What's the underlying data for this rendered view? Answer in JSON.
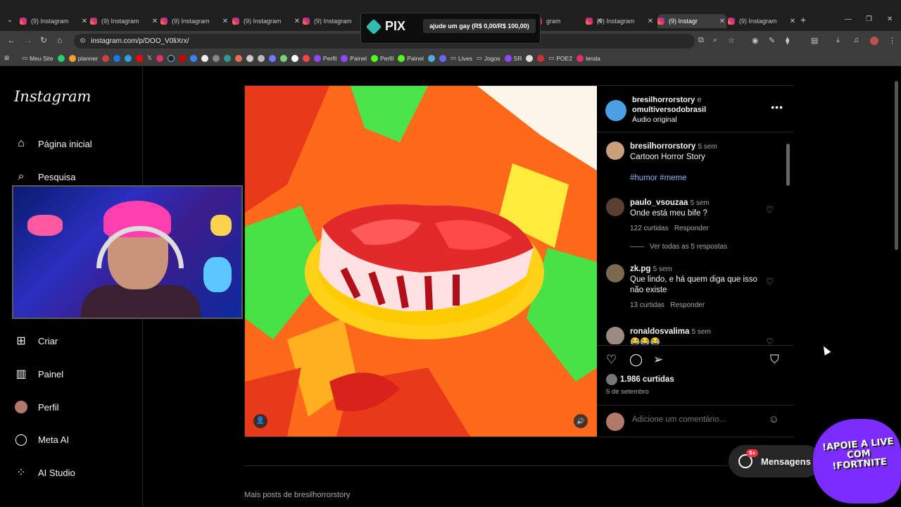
{
  "browser": {
    "tabs": [
      {
        "title": "(9) Instagram",
        "left": 0
      },
      {
        "title": "(9) Instagram"
      },
      {
        "title": "(9) Instagram"
      },
      {
        "title": "(9) Instagram"
      },
      {
        "title": "(9) Instagram"
      },
      {
        "title": "(9) Instagram"
      },
      {
        "title": "gram"
      },
      {
        "title": "(9) Instagram"
      },
      {
        "title": "(9) Instagr"
      },
      {
        "title": "(9) Instagram"
      }
    ],
    "url": "instagram.com/p/DOO_V0liXrx/",
    "bookmarks": [
      "Meu Site",
      "planner",
      "Perfil",
      "Painel",
      "Perfil",
      "Painel",
      "Lives",
      "Jogos",
      "SR",
      "POE2",
      "lenda"
    ]
  },
  "pix": {
    "logo": "PIX",
    "goal": "ajude um gay (R$ 0,00/R$ 100,00)"
  },
  "sidebar": {
    "logo": "Instagram",
    "items": [
      {
        "label": "Página inicial",
        "icon": "home-icon"
      },
      {
        "label": "Pesquisa",
        "icon": "search-icon"
      },
      {
        "label": "Criar",
        "icon": "plus-square-icon"
      },
      {
        "label": "Painel",
        "icon": "chart-icon"
      },
      {
        "label": "Perfil",
        "icon": "avatar-icon"
      },
      {
        "label": "Meta AI",
        "icon": "meta-ai-icon"
      },
      {
        "label": "AI Studio",
        "icon": "ai-studio-icon"
      }
    ]
  },
  "post": {
    "author_line1": "bresilhorrorstory",
    "author_join": "e",
    "author_line2": "omultiversodobrasil",
    "audio": "Áudio original",
    "caption": {
      "user": "bresilhorrorstory",
      "time": "5 sem",
      "text": "Cartoon Horror Story",
      "tags": "#humor #meme"
    },
    "comments": [
      {
        "user": "paulo_vsouzaa",
        "time": "5 sem",
        "text": "Onde está meu bife ?",
        "likes": "122 curtidas",
        "reply": "Responder"
      },
      {
        "user": "zk.pg",
        "time": "5 sem",
        "text": "Que lindo, e há quem diga que isso não existe",
        "likes": "13 curtidas",
        "reply": "Responder"
      },
      {
        "user": "ronaldosvalima",
        "time": "5 sem",
        "text": "😂😂😂"
      }
    ],
    "see_all": "Ver todas as 5 respostas",
    "likes": "1.986 curtidas",
    "date": "5 de setembro",
    "comment_placeholder": "Adicione um comentário..."
  },
  "more_posts": "Mais posts de bresilhorrorstory",
  "messages": {
    "label": "Mensagens",
    "badge": "9+"
  },
  "overlay": {
    "fortnite": "!APOIE A LIVE COM !FORTNITE"
  },
  "colors": {
    "accent": "#8ab4f8",
    "badge": "#ff3040",
    "pix": "#32bcad"
  }
}
